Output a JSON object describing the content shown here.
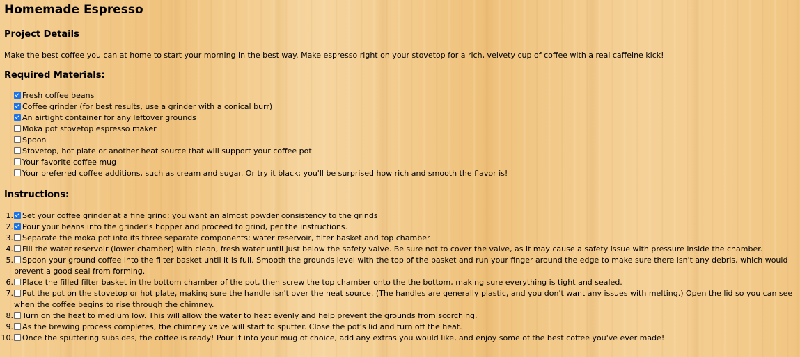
{
  "title": "Homemade Espresso",
  "project": {
    "heading": "Project Details",
    "description": "Make the best coffee you can at home to start your morning in the best way. Make espresso right on your stovetop for a rich, velvety cup of coffee with a real caffeine kick!"
  },
  "materials": {
    "heading": "Required Materials:",
    "items": [
      {
        "label": "Fresh coffee beans",
        "checked": true
      },
      {
        "label": "Coffee grinder (for best results, use a grinder with a conical burr)",
        "checked": true
      },
      {
        "label": "An airtight container for any leftover grounds",
        "checked": true
      },
      {
        "label": "Moka pot stovetop espresso maker",
        "checked": false
      },
      {
        "label": "Spoon",
        "checked": false
      },
      {
        "label": "Stovetop, hot plate or another heat source that will support your coffee pot",
        "checked": false
      },
      {
        "label": "Your favorite coffee mug",
        "checked": false
      },
      {
        "label": "Your preferred coffee additions, such as cream and sugar. Or try it black; you'll be surprised how rich and smooth the flavor is!",
        "checked": false
      }
    ]
  },
  "instructions": {
    "heading": "Instructions:",
    "steps": [
      {
        "num": "1.",
        "label": "Set your coffee grinder at a fine grind; you want an almost powder consistency to the grinds",
        "checked": true
      },
      {
        "num": "2.",
        "label": "Pour your beans into the grinder's hopper and proceed to grind, per the instructions.",
        "checked": true
      },
      {
        "num": "3.",
        "label": "Separate the moka pot into its three separate components; water reservoir, filter basket and top chamber",
        "checked": false
      },
      {
        "num": "4.",
        "label": "Fill the water reservoir (lower chamber) with clean, fresh water until just below the safety valve. Be sure not to cover the valve, as it may cause a safety issue with pressure inside the chamber.",
        "checked": false
      },
      {
        "num": "5.",
        "label": "Spoon your ground coffee into the filter basket until it is full. Smooth the grounds level with the top of the basket and run your finger around the edge to make sure there isn't any debris, which would prevent a good seal from forming.",
        "checked": false
      },
      {
        "num": "6.",
        "label": "Place the filled filter basket in the bottom chamber of the pot, then screw the top chamber onto the the bottom, making sure everything is tight and sealed.",
        "checked": false
      },
      {
        "num": "7.",
        "label": "Put the pot on the stovetop or hot plate, making sure the handle isn't over the heat source. (The handles are generally plastic, and you don't want any issues with melting.) Open the lid so you can see when the coffee begins to rise through the chimney.",
        "checked": false
      },
      {
        "num": "8.",
        "label": "Turn on the heat to medium low. This will allow the water to heat evenly and help prevent the grounds from scorching.",
        "checked": false
      },
      {
        "num": "9.",
        "label": "As the brewing process completes, the chimney valve will start to sputter. Close the pot's lid and turn off the heat.",
        "checked": false
      },
      {
        "num": "10.",
        "label": "Once the sputtering subsides, the coffee is ready! Pour it into your mug of choice, add any extras you would like, and enjoy some of the best coffee you've ever made!",
        "checked": false
      }
    ]
  }
}
